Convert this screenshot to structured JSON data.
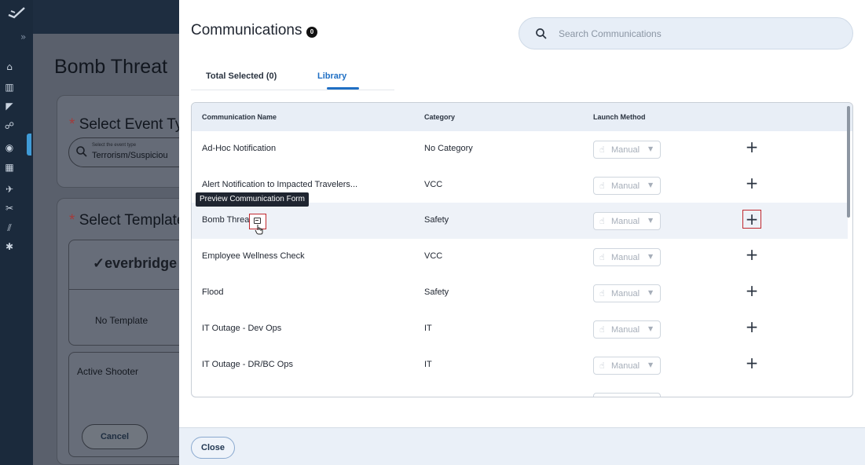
{
  "rail": {
    "expand_glyph": "»",
    "icons": [
      "home-icon",
      "building-icon",
      "megaphone-icon",
      "people-icon",
      "location-icon",
      "calendar-icon",
      "airplane-icon",
      "tools-icon",
      "chart-icon",
      "settings-icon"
    ]
  },
  "background_page": {
    "title": "Bomb Threat",
    "event_section_title": "Select Event Ty",
    "event_input_caption": "Select the event type",
    "event_input_value": "Terrorism/Suspiciou",
    "template_section_title": "Select Template",
    "required_mark": "*",
    "templates": [
      "No Template",
      "Active Shooter"
    ],
    "brand_logo_text": "everbridge",
    "cancel_label": "Cancel"
  },
  "modal": {
    "title": "Communications",
    "count_badge": "0",
    "search_placeholder": "Search Communications",
    "tabs": [
      {
        "label": "Total Selected (0)",
        "active": false
      },
      {
        "label": "Library",
        "active": true
      }
    ],
    "columns": [
      "Communication Name",
      "Category",
      "Launch Method"
    ],
    "rows": [
      {
        "name": "Ad-Hoc Notification",
        "category": "No Category",
        "launch": "Manual",
        "add": "+"
      },
      {
        "name": "Alert Notification to Impacted Travelers...",
        "category": "VCC",
        "launch": "Manual",
        "add": "+"
      },
      {
        "name": "Bomb Threat",
        "category": "Safety",
        "launch": "Manual",
        "add": "+"
      },
      {
        "name": "Employee Wellness Check",
        "category": "VCC",
        "launch": "Manual",
        "add": "+"
      },
      {
        "name": "Flood",
        "category": "Safety",
        "launch": "Manual",
        "add": "+"
      },
      {
        "name": "IT Outage - Dev Ops",
        "category": "IT",
        "launch": "Manual",
        "add": "+"
      },
      {
        "name": "IT Outage - DR/BC Ops",
        "category": "IT",
        "launch": "Manual",
        "add": "+"
      }
    ],
    "highlighted_row": 2,
    "tooltip": "Preview Communication Form",
    "close_label": "Close",
    "accent_color": "#1f6fc4",
    "highlight_color": "#c0282e"
  }
}
